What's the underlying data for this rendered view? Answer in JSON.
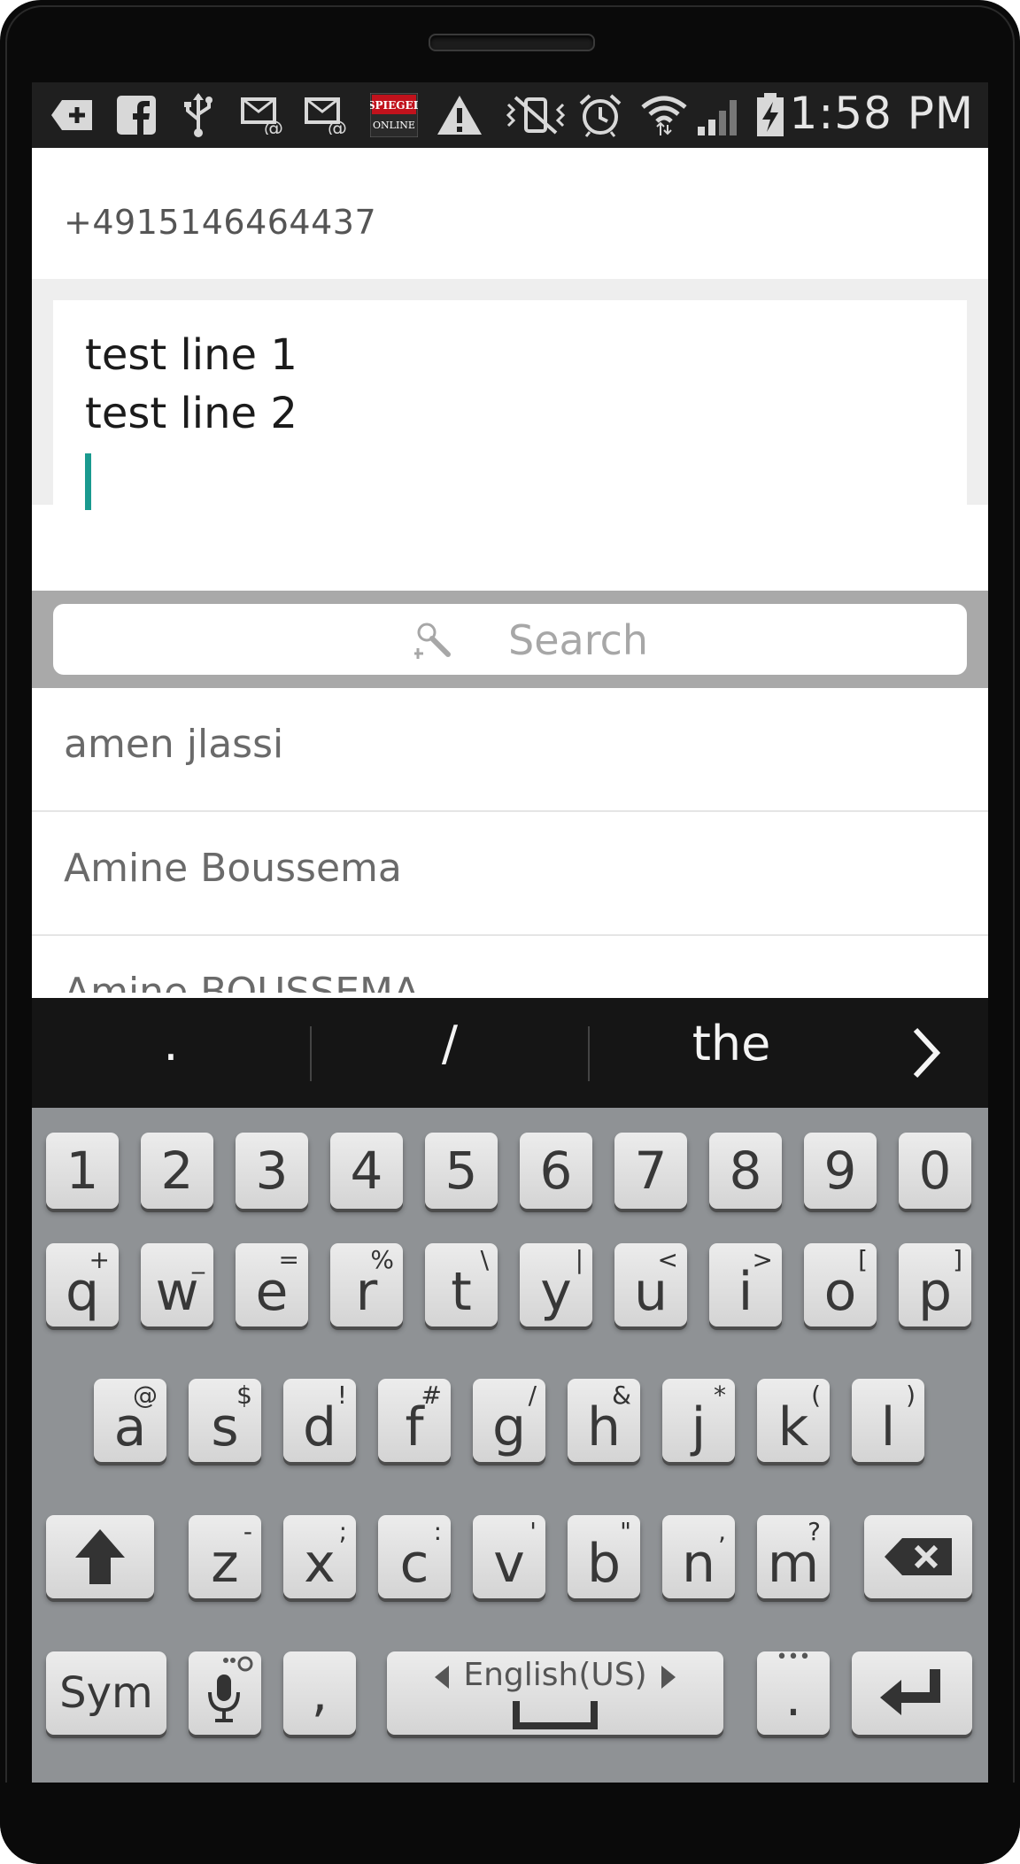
{
  "status_bar": {
    "time": "1:58 PM",
    "icons": [
      "add-icon",
      "facebook-icon",
      "usb-icon",
      "email-icon",
      "email-icon-2",
      "spiegel-online-icon",
      "warning-icon",
      "vibrate-icon",
      "alarm-icon",
      "wifi-icon",
      "signal-icon",
      "battery-charging-icon"
    ],
    "spiegel_text_1": "SPIEGEL",
    "spiegel_text_2": "ONLINE"
  },
  "recipient": {
    "number": "+4915146464437"
  },
  "compose": {
    "lines": [
      "test line 1",
      "test line 2"
    ]
  },
  "search": {
    "placeholder": "Search"
  },
  "contacts": [
    "amen jlassi",
    "Amine Boussema",
    "Amine BOUSSEMA"
  ],
  "suggestions": [
    ".",
    "/",
    "the"
  ],
  "keyboard": {
    "numbers": [
      "1",
      "2",
      "3",
      "4",
      "5",
      "6",
      "7",
      "8",
      "9",
      "0"
    ],
    "row_q": [
      [
        "q",
        "+"
      ],
      [
        "w",
        "_"
      ],
      [
        "e",
        "="
      ],
      [
        "r",
        "%"
      ],
      [
        "t",
        "\\"
      ],
      [
        "y",
        "|"
      ],
      [
        "u",
        "<"
      ],
      [
        "i",
        ">"
      ],
      [
        "o",
        "["
      ],
      [
        "p",
        "]"
      ]
    ],
    "row_a": [
      [
        "a",
        "@"
      ],
      [
        "s",
        "$"
      ],
      [
        "d",
        "!"
      ],
      [
        "f",
        "#"
      ],
      [
        "g",
        "/"
      ],
      [
        "h",
        "&"
      ],
      [
        "j",
        "*"
      ],
      [
        "k",
        "("
      ],
      [
        "l",
        ")"
      ]
    ],
    "row_z": [
      [
        "z",
        "-"
      ],
      [
        "x",
        ";"
      ],
      [
        "c",
        ":"
      ],
      [
        "v",
        "'"
      ],
      [
        "b",
        "\""
      ],
      [
        "n",
        ","
      ],
      [
        "m",
        "?"
      ]
    ],
    "sym": "Sym",
    "comma": ",",
    "space_label": "English(US)",
    "period": ".",
    "period_extra": "•••"
  },
  "colors": {
    "cursor": "#1a9a8f",
    "keyboard_bg": "#8f9295",
    "status_bg": "#1f1f1f"
  }
}
